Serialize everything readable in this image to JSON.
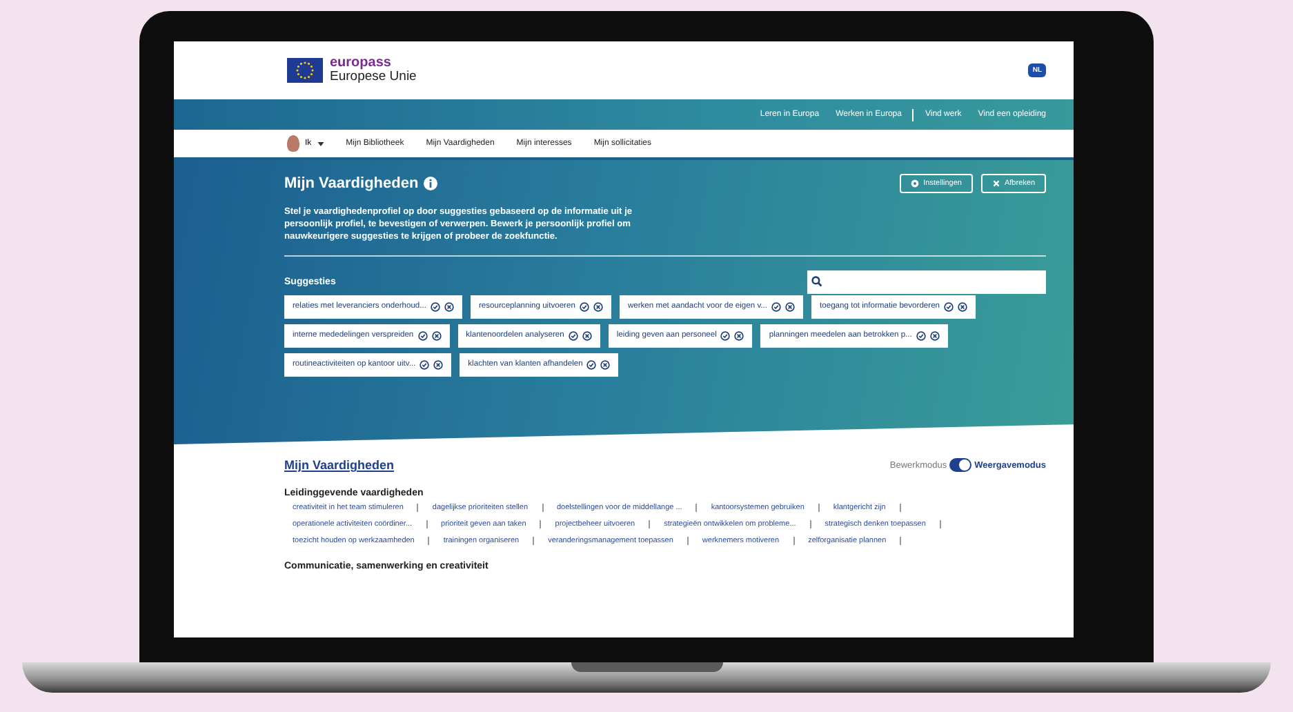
{
  "header": {
    "brand": "europass",
    "subtitle": "Europese Unie",
    "language": "NL"
  },
  "top_nav": [
    {
      "links": [
        {
          "label": "Leren in Europa"
        },
        {
          "label": "Werken in Europa"
        }
      ]
    },
    {
      "links": [
        {
          "label": "Vind werk"
        },
        {
          "label": "Vind een opleiding"
        }
      ]
    }
  ],
  "user_menu": {
    "user": "Ik",
    "items": [
      {
        "label": "Mijn Bibliotheek"
      },
      {
        "label": "Mijn Vaardigheden"
      },
      {
        "label": "Mijn interesses"
      },
      {
        "label": "Mijn sollicitaties"
      }
    ]
  },
  "hero": {
    "title": "Mijn Vaardigheden",
    "buttons": [
      {
        "label": "Instellingen",
        "kind": "settings"
      },
      {
        "label": "Afbreken",
        "kind": "cancel"
      }
    ],
    "description": "Stel je vaardighedenprofiel op door suggesties gebaseerd op de informatie uit je persoonlijk profiel, te bevestigen of verwerpen. Bewerk je persoonlijk profiel om nauwkeurigere suggesties te krijgen of probeer de zoekfunctie.",
    "suggestions_title": "Suggesties",
    "suggestions": [
      {
        "label": "relaties met leveranciers onderhoud..."
      },
      {
        "label": "resourceplanning uitvoeren"
      },
      {
        "label": "werken met aandacht voor de eigen v..."
      },
      {
        "label": "toegang tot informatie bevorderen"
      },
      {
        "label": "interne mededelingen verspreiden"
      },
      {
        "label": "klantenoordelen analyseren"
      },
      {
        "label": "leiding geven aan personeel"
      },
      {
        "label": "planningen meedelen aan betrokken p..."
      },
      {
        "label": "routineactiviteiten op kantoor uitv..."
      },
      {
        "label": "klachten van klanten afhandelen"
      }
    ]
  },
  "skills": {
    "title": "Mijn Vaardigheden",
    "mode_toggle": {
      "left_label": "Bewerkmodus",
      "right_label": "Weergavemodus",
      "on": true
    },
    "groups": [
      {
        "title": "Leidinggevende vaardigheden",
        "items": [
          "creativiteit in het team stimuleren",
          "dagelijkse prioriteiten stellen",
          "doelstellingen voor de middellange ...",
          "kantoorsystemen gebruiken",
          "klantgericht zijn",
          "operationele activiteiten coördiner...",
          "prioriteit geven aan taken",
          "projectbeheer uitvoeren",
          "strategieën ontwikkelen om probleme...",
          "strategisch denken toepassen",
          "toezicht houden op werkzaamheden",
          "trainingen organiseren",
          "veranderingsmanagement toepassen",
          "werknemers motiveren",
          "zelforganisatie plannen"
        ]
      },
      {
        "title": "Communicatie, samenwerking en creativiteit"
      }
    ]
  }
}
